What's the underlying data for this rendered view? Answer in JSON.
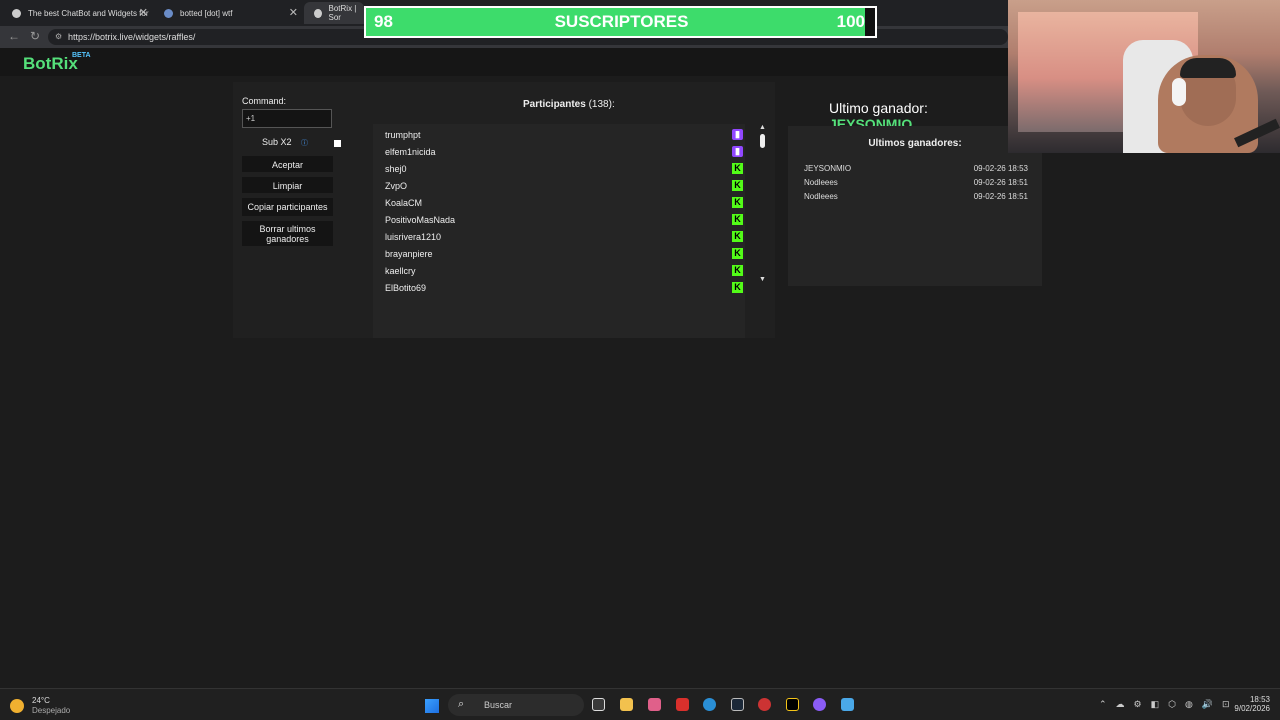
{
  "browser": {
    "tabs": [
      {
        "label": "The best ChatBot and Widgets for"
      },
      {
        "label": "botted [dot] wtf"
      },
      {
        "label": "BotRix | Sor"
      }
    ],
    "url": "https://botrix.live/widgets/raffles/"
  },
  "overlay": {
    "sub_current": "98",
    "sub_label": "SUSCRIPTORES",
    "sub_goal": "100",
    "sub_progress": 0.98
  },
  "app": {
    "logo": "BotRix",
    "logo_badge": "BETA"
  },
  "raffle": {
    "command_label": "Command:",
    "command_value": "+1",
    "sub_label": "Sub X2",
    "accept_label": "Aceptar",
    "clear_label": "Limpiar",
    "copy_label": "Copiar participantes",
    "delete_label_line1": "Borrar ultimos",
    "delete_label_line2": "ganadores"
  },
  "participants": {
    "title": "Participantes",
    "count": "(138)",
    "suffix": ":",
    "items": [
      {
        "name": "trumphpt",
        "platform": "twitch"
      },
      {
        "name": "elfem1nicida",
        "platform": "twitch"
      },
      {
        "name": "shej0",
        "platform": "kick"
      },
      {
        "name": "ZvpO",
        "platform": "kick"
      },
      {
        "name": "KoalaCM",
        "platform": "kick"
      },
      {
        "name": "PositivoMasNada",
        "platform": "kick"
      },
      {
        "name": "luisrivera1210",
        "platform": "kick"
      },
      {
        "name": "brayanpiere",
        "platform": "kick"
      },
      {
        "name": "kaellcry",
        "platform": "kick"
      },
      {
        "name": "ElBotito69",
        "platform": "kick"
      }
    ]
  },
  "winner": {
    "label": "Ultimo ganador:",
    "name": "JEYSONMIO"
  },
  "last_winners": {
    "title": "Ultimos ganadores:",
    "rows": [
      {
        "name": "JEYSONMIO",
        "time": "09-02-26 18:53"
      },
      {
        "name": "Nodleees",
        "time": "09-02-26 18:51"
      },
      {
        "name": "Nodleees",
        "time": "09-02-26 18:51"
      }
    ]
  },
  "taskbar": {
    "temperature": "24°C",
    "condition": "Despejado",
    "search_placeholder": "Buscar",
    "time": "18:53",
    "date": "9/02/2026"
  },
  "colors": {
    "accent_green": "#55e07a",
    "sub_fill": "#3ddc6b",
    "twitch": "#9147ff",
    "kick": "#53fc18"
  }
}
